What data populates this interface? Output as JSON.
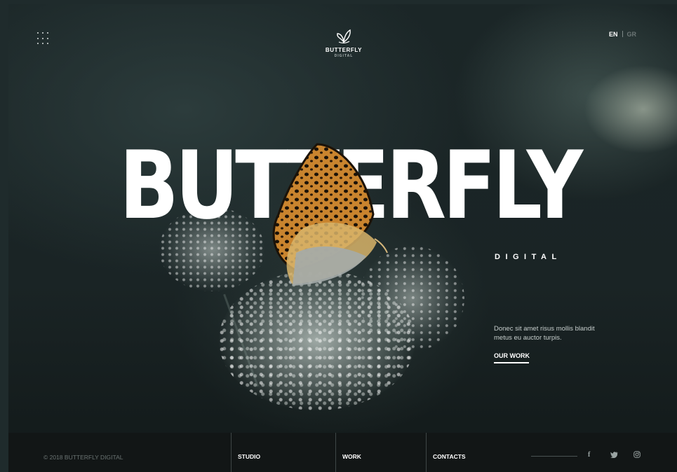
{
  "header": {
    "menu_icon": "grid-menu-icon",
    "logo": {
      "icon": "butterfly-logo-icon",
      "name": "BUTTERFLY",
      "sub": "DIGITAL"
    },
    "languages": {
      "active": "EN",
      "other": "GR"
    }
  },
  "hero": {
    "title": "BUTTERFLY",
    "subtitle": "DIGITAL",
    "description": "Donec sit amet risus mollis blandit metus eu auctor turpis.",
    "cta_label": "OUR WORK"
  },
  "footer": {
    "copyright": "© 2018 BUTTERFLY DIGITAL",
    "nav": [
      {
        "label": "STUDIO"
      },
      {
        "label": "WORK"
      },
      {
        "label": "CONTACTS"
      }
    ],
    "social": [
      {
        "icon": "facebook-icon",
        "glyph": "f"
      },
      {
        "icon": "twitter-icon"
      },
      {
        "icon": "instagram-icon"
      }
    ]
  },
  "colors": {
    "background": "#1a2425",
    "text": "#ffffff",
    "butterfly_wing": "#c9842e",
    "footer": "#121616"
  }
}
